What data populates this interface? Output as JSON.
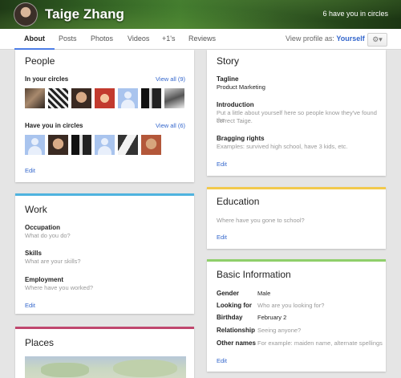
{
  "profile": {
    "name": "Taige Zhang",
    "circle_count": "6 have you in circles"
  },
  "tabs": [
    "About",
    "Posts",
    "Photos",
    "Videos",
    "+1's",
    "Reviews"
  ],
  "view_as": {
    "label": "View profile as:",
    "value": "Yourself"
  },
  "people": {
    "title": "People",
    "in_circles": {
      "label": "In your circles",
      "view_all": "View all (9)"
    },
    "have_you": {
      "label": "Have you in circles",
      "view_all": "View all (6)"
    },
    "edit": "Edit"
  },
  "work": {
    "title": "Work",
    "accent": "#4fb3df",
    "fields": [
      {
        "label": "Occupation",
        "hint": "What do you do?"
      },
      {
        "label": "Skills",
        "hint": "What are your skills?"
      },
      {
        "label": "Employment",
        "hint": "Where have you worked?"
      }
    ],
    "edit": "Edit"
  },
  "places": {
    "title": "Places",
    "accent": "#c0476e"
  },
  "story": {
    "title": "Story",
    "tagline_label": "Tagline",
    "tagline_value": "Product Marketing",
    "intro_label": "Introduction",
    "intro_hint_1": "Put a little about yourself here so people know they've found the",
    "intro_hint_2": "correct Taige.",
    "bragging_label": "Bragging rights",
    "bragging_hint": "Examples: survived high school, have 3 kids, etc.",
    "edit": "Edit"
  },
  "education": {
    "title": "Education",
    "accent": "#f2c94c",
    "hint": "Where have you gone to school?",
    "edit": "Edit"
  },
  "basic": {
    "title": "Basic Information",
    "accent": "#8fcf6a",
    "rows": [
      {
        "label": "Gender",
        "value": "Male",
        "placeholder": false
      },
      {
        "label": "Looking for",
        "value": "Who are you looking for?",
        "placeholder": true
      },
      {
        "label": "Birthday",
        "value": "February 2",
        "placeholder": false
      },
      {
        "label": "Relationship",
        "value": "Seeing anyone?",
        "placeholder": true
      },
      {
        "label": "Other names",
        "value": "For example: maiden name, alternate spellings",
        "placeholder": true
      }
    ],
    "edit": "Edit"
  },
  "icons": {
    "gear": "gear-icon",
    "caret": "chevron-down-icon"
  }
}
